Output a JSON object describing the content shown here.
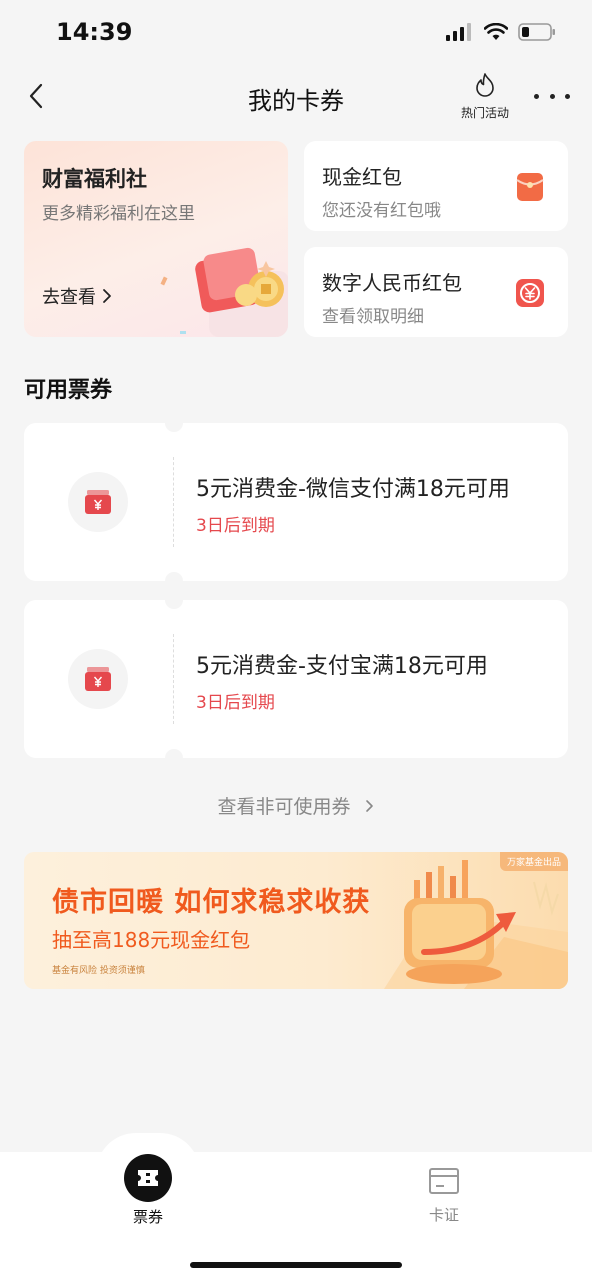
{
  "status_bar": {
    "time": "14:39"
  },
  "nav": {
    "title": "我的卡券",
    "hot_label": "热门活动"
  },
  "wealth_card": {
    "title": "财富福利社",
    "subtitle": "更多精彩福利在这里",
    "link": "去查看"
  },
  "cash_card": {
    "title": "现金红包",
    "subtitle": "您还没有红包哦"
  },
  "ecny_card": {
    "title": "数字人民币红包",
    "subtitle": "查看领取明细"
  },
  "section_title": "可用票券",
  "coupons": [
    {
      "name": "5元消费金-微信支付满18元可用",
      "expiry": "3日后到期"
    },
    {
      "name": "5元消费金-支付宝满18元可用",
      "expiry": "3日后到期"
    }
  ],
  "view_unusable": "查看非可使用券",
  "banner": {
    "tag": "万家基金出品",
    "headline": "债市回暖 如何求稳求收获",
    "subline": "抽至高188元现金红包",
    "note": "基金有风险 投资须谨慎"
  },
  "tabbar": {
    "tabs": [
      {
        "label": "票券",
        "icon": "ticket-icon",
        "active": true
      },
      {
        "label": "卡证",
        "icon": "card-icon",
        "active": false
      }
    ]
  },
  "colors": {
    "accent_red": "#e5484d",
    "banner_orange": "#f05a1e",
    "background": "#f5f5f5"
  }
}
